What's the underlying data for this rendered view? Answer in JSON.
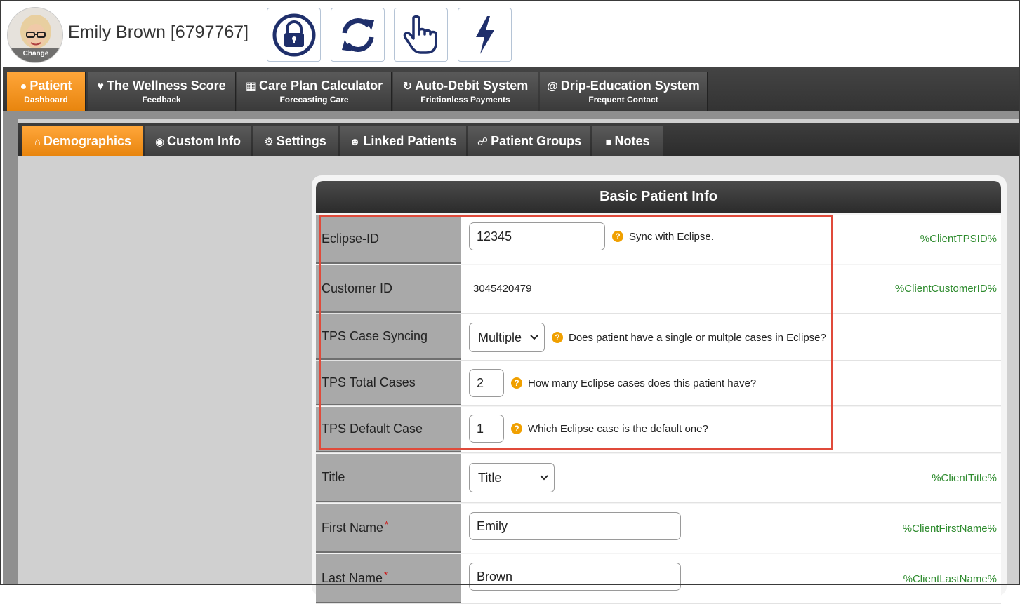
{
  "header": {
    "avatar_change_label": "Change",
    "patient_name": "Emily Brown [6797767]",
    "buttons": [
      {
        "icon": "lock-icon"
      },
      {
        "icon": "refresh-icon"
      },
      {
        "icon": "pointer-hand-icon"
      },
      {
        "icon": "lightning-icon"
      }
    ]
  },
  "topnav": {
    "tabs": [
      {
        "label": "Patient",
        "sublabel": "Dashboard",
        "icon": "user-icon",
        "active": true
      },
      {
        "label": "The Wellness Score",
        "sublabel": "Feedback",
        "icon": "heartbeat-icon",
        "active": false
      },
      {
        "label": "Care Plan Calculator",
        "sublabel": "Forecasting Care",
        "icon": "calculator-icon",
        "active": false
      },
      {
        "label": "Auto-Debit System",
        "sublabel": "Frictionless Payments",
        "icon": "refresh-icon",
        "active": false
      },
      {
        "label": "Drip-Education System",
        "sublabel": "Frequent Contact",
        "icon": "at-icon",
        "active": false
      }
    ]
  },
  "subnav": {
    "tabs": [
      {
        "label": "Demographics",
        "icon": "home-icon",
        "active": true
      },
      {
        "label": "Custom Info",
        "icon": "target-icon",
        "active": false
      },
      {
        "label": "Settings",
        "icon": "gear-icon",
        "active": false
      },
      {
        "label": "Linked Patients",
        "icon": "users-icon",
        "active": false
      },
      {
        "label": "Patient Groups",
        "icon": "group-icon",
        "active": false
      },
      {
        "label": "Notes",
        "icon": "note-icon",
        "active": false
      }
    ]
  },
  "panel": {
    "title": "Basic Patient Info",
    "rows": {
      "eclipse_id": {
        "label": "Eclipse-ID",
        "value": "12345",
        "hint": "Sync with Eclipse.",
        "var": "%ClientTPSID%"
      },
      "customer_id": {
        "label": "Customer ID",
        "value": "3045420479",
        "var": "%ClientCustomerID%"
      },
      "tps_case_syncing": {
        "label": "TPS Case Syncing",
        "value": "Multiple",
        "hint": "Does patient have a single or multple cases in Eclipse?"
      },
      "tps_total_cases": {
        "label": "TPS Total Cases",
        "value": "2",
        "hint": "How many Eclipse cases does this patient have?"
      },
      "tps_default_case": {
        "label": "TPS Default Case",
        "value": "1",
        "hint": "Which Eclipse case is the default one?"
      },
      "title": {
        "label": "Title",
        "value": "Title",
        "var": "%ClientTitle%"
      },
      "first_name": {
        "label": "First Name",
        "required_mark": "*",
        "value": "Emily",
        "var": "%ClientFirstName%"
      },
      "last_name": {
        "label": "Last Name",
        "required_mark": "*",
        "value": "Brown",
        "var": "%ClientLastName%"
      }
    },
    "help_glyph": "?",
    "highlight_color": "#e04a3a"
  },
  "colors": {
    "accent_orange": "#f0901a",
    "variable_green": "#2e8b2e",
    "icon_navy": "#1f2f6b"
  }
}
